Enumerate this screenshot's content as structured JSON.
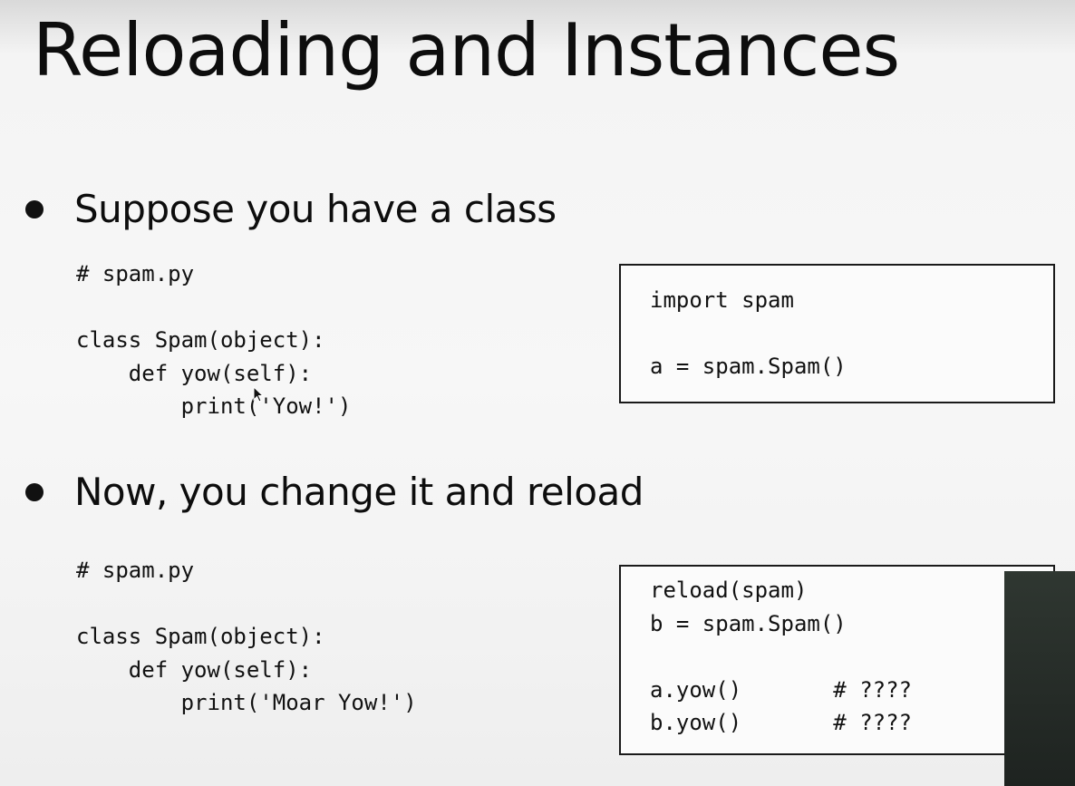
{
  "slide": {
    "title": "Reloading and Instances",
    "bullet1": "Suppose you have a class",
    "bullet2": "Now, you change it and reload"
  },
  "code1": {
    "lines": [
      "# spam.py",
      "",
      "class Spam(object):",
      "    def yow(self):",
      "        print('Yow!')"
    ]
  },
  "box1": {
    "lines": [
      "import spam",
      "",
      "a = spam.Spam()"
    ]
  },
  "code2": {
    "lines": [
      "# spam.py",
      "",
      "class Spam(object):",
      "    def yow(self):",
      "        print('Moar Yow!')"
    ]
  },
  "box2": {
    "lines": [
      "reload(spam)",
      "b = spam.Spam()",
      "",
      "a.yow()       # ????",
      "b.yow()       # ????"
    ]
  },
  "icons": {
    "bullet": "bullet-dot-icon",
    "cursor": "mouse-cursor-icon"
  },
  "colors": {
    "background": "#f4f4f4",
    "text": "#0d0d0d",
    "box_border": "#1a1a1a",
    "overlay": "#2a312c"
  }
}
